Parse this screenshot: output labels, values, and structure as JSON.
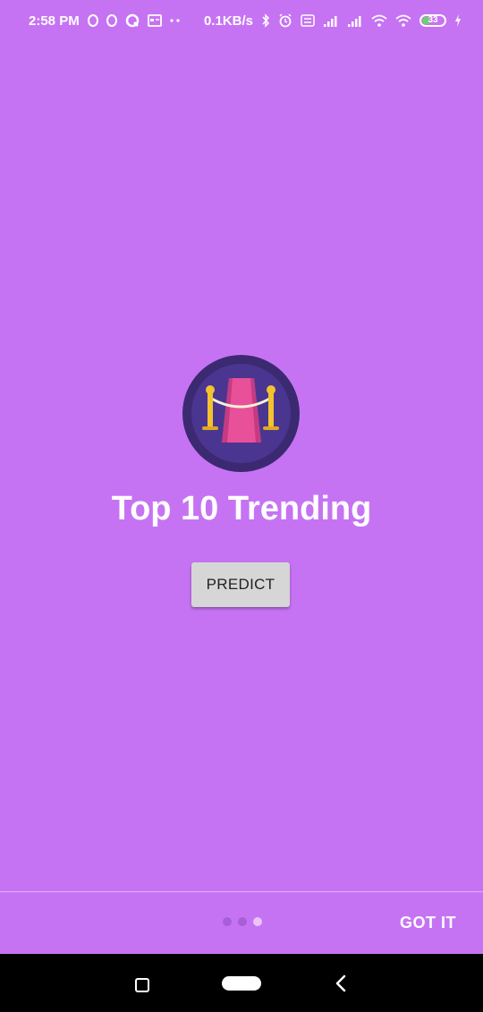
{
  "status_bar": {
    "time": "2:58 PM",
    "net_speed": "0.1KB/s",
    "battery": "33",
    "icons": [
      "opera-icon",
      "opera-icon",
      "notification-icon",
      "calendar-icon",
      "dots-icon",
      "bluetooth-icon",
      "alarm-icon",
      "volte-icon",
      "signal-icon",
      "signal-icon",
      "wifi-icon",
      "wifi-icon",
      "battery-icon",
      "charging-icon"
    ]
  },
  "main": {
    "title": "Top 10 Trending",
    "predict_label": "PREDICT",
    "hero_icon": "red-carpet-icon"
  },
  "footer": {
    "got_it_label": "GOT IT",
    "pages": 3,
    "active_page": 3
  },
  "nav": {
    "icons": [
      "recents-icon",
      "home-icon",
      "back-icon"
    ]
  },
  "colors": {
    "background": "#c673f3",
    "hero_circle": "#3b2a72",
    "carpet": "#e8509a",
    "post": "#f2c230"
  }
}
